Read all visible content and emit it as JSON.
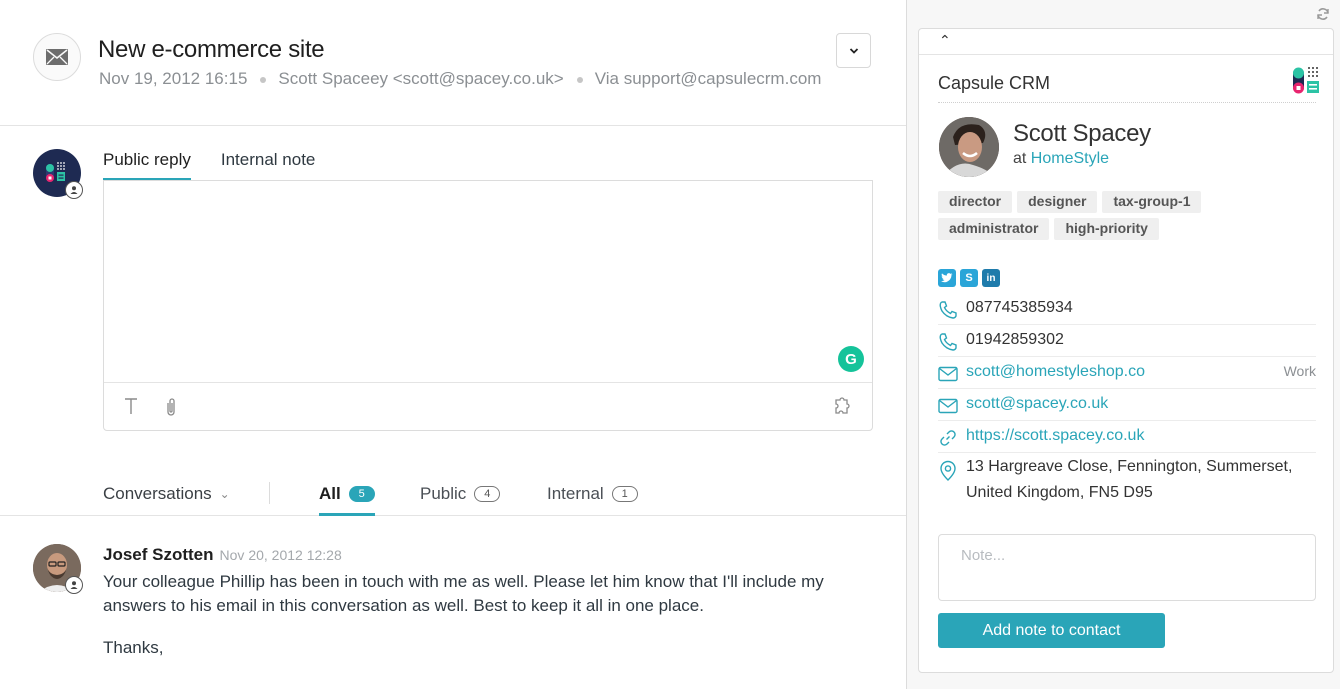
{
  "ticket": {
    "title": "New e-commerce site",
    "date": "Nov 19, 2012 16:15",
    "requester": "Scott Spaceey <scott@spacey.co.uk>",
    "via": "Via support@capsulecrm.com",
    "icon": "envelope-icon"
  },
  "reply": {
    "tabs": [
      {
        "label": "Public reply",
        "active": true
      },
      {
        "label": "Internal note",
        "active": false
      }
    ],
    "body_value": "",
    "grammarly_label": "G",
    "toolbar_icons": [
      "text-format-icon",
      "attachment-icon",
      "apps-puzzle-icon"
    ]
  },
  "conversations": {
    "selector_label": "Conversations",
    "filters": [
      {
        "label": "All",
        "count": "5",
        "active": true
      },
      {
        "label": "Public",
        "count": "4",
        "active": false
      },
      {
        "label": "Internal",
        "count": "1",
        "active": false
      }
    ]
  },
  "message": {
    "author": "Josef Szotten",
    "time": "Nov 20, 2012 12:28",
    "paragraphs": [
      "Your colleague Phillip has been in touch with me as well. Please let him know that I'll include my answers to his email in this conversation as well. Best to keep it all in one place.",
      "Thanks,"
    ]
  },
  "sidebar": {
    "app_title": "Capsule CRM",
    "contact": {
      "name": "Scott Spacey",
      "org_prefix": "at",
      "org": "HomeStyle",
      "tags": [
        "director",
        "designer",
        "tax-group-1",
        "administrator",
        "high-priority"
      ],
      "socials": [
        {
          "name": "twitter-icon",
          "glyph": "t",
          "color": "#2aa5d8"
        },
        {
          "name": "skype-icon",
          "glyph": "S",
          "color": "#2aa5d8"
        },
        {
          "name": "linkedin-icon",
          "glyph": "in",
          "color": "#1e7bab"
        }
      ],
      "phones": [
        "087745385934",
        "01942859302"
      ],
      "emails": [
        {
          "value": "scott@homestyleshop.co",
          "label": "Work"
        },
        {
          "value": "scott@spacey.co.uk",
          "label": ""
        }
      ],
      "website": "https://scott.spacey.co.uk",
      "address": "13 Hargreave Close, Fennington, Summerset, United Kingdom, FN5 D95"
    },
    "note_placeholder": "Note...",
    "note_value": "",
    "add_note_label": "Add note to contact"
  },
  "colors": {
    "accent": "#2aa5b8",
    "grammarly": "#15c39a",
    "brand_navy": "#1e2a52",
    "brand_teal": "#2cc3a5",
    "brand_pink": "#e8256f"
  }
}
